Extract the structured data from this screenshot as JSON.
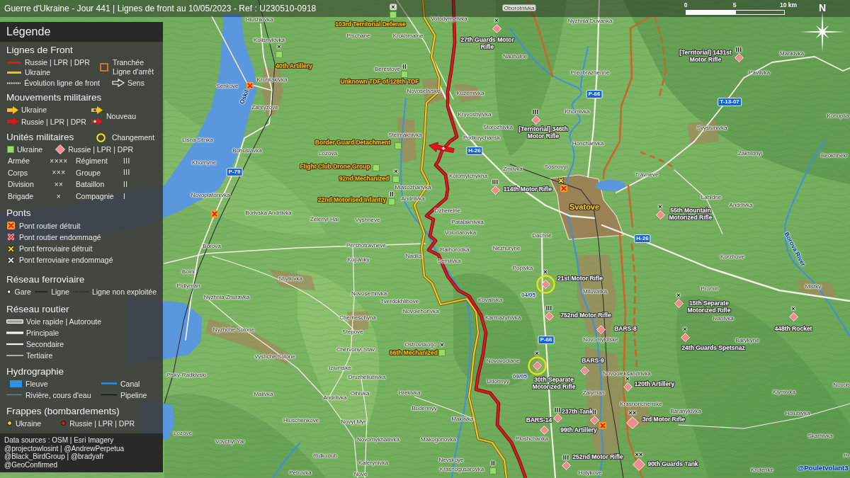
{
  "title": "Guerre d'Ukraine - Jour 441 | Lignes de front au 10/05/2023 - Ref : U230510-0918",
  "scale_bar": {
    "ticks": [
      "0",
      "5",
      "10 km"
    ]
  },
  "compass": {
    "label": "N"
  },
  "legend": {
    "title": "Légende",
    "front_lines": {
      "title": "Lignes de Front",
      "items": [
        {
          "kind": "russia",
          "label": "Russie | LPR | DPR"
        },
        {
          "kind": "ukraine",
          "label": "Ukraine"
        },
        {
          "kind": "evolution",
          "label": "Évolution ligne de front"
        }
      ],
      "trench": "Tranchée\nLigne d'arrêt",
      "direction": "Sens"
    },
    "movements": {
      "title": "Mouvements militaires",
      "items": [
        {
          "kind": "ukraine",
          "label": "Ukraine"
        },
        {
          "kind": "russia",
          "label": "Russie | LPR | DPR"
        }
      ],
      "new_label": "Nouveau"
    },
    "units": {
      "title": "Unités militaires",
      "change_label": "Changement",
      "sides": [
        {
          "kind": "ukraine",
          "label": "Ukraine"
        },
        {
          "kind": "russia",
          "label": "Russie | LPR | DPR"
        }
      ],
      "echelons": [
        {
          "name": "Armée",
          "symbol": "××××"
        },
        {
          "name": "Régiment",
          "symbol": "III"
        },
        {
          "name": "Corps",
          "symbol": "×××"
        },
        {
          "name": "Groupe",
          "symbol": "III"
        },
        {
          "name": "Division",
          "symbol": "××"
        },
        {
          "name": "Bataillon",
          "symbol": "II"
        },
        {
          "name": "Brigade",
          "symbol": "×"
        },
        {
          "name": "Compagnie",
          "symbol": "I"
        }
      ]
    },
    "bridges": {
      "title": "Ponts",
      "items": [
        {
          "kind": "road_destroyed",
          "label": "Pont routier détruit"
        },
        {
          "kind": "road_damaged",
          "label": "Pont routier endommagé"
        },
        {
          "kind": "rail_destroyed",
          "label": "Pont ferroviaire détruit"
        },
        {
          "kind": "rail_damaged",
          "label": "Pont ferroviaire endommagé"
        }
      ]
    },
    "railway": {
      "title": "Réseau ferroviaire",
      "items": [
        {
          "kind": "station",
          "label": "Gare"
        },
        {
          "kind": "line",
          "label": "Ligne"
        },
        {
          "kind": "unused",
          "label": "Ligne non exploitée"
        }
      ]
    },
    "roads": {
      "title": "Réseau routier",
      "items": [
        {
          "kind": "highway",
          "label": "Voie rapide | Autoroute"
        },
        {
          "kind": "primary",
          "label": "Principale"
        },
        {
          "kind": "secondary",
          "label": "Secondaire"
        },
        {
          "kind": "tertiary",
          "label": "Tertiaire"
        }
      ]
    },
    "hydrography": {
      "title": "Hydrographie",
      "items": [
        {
          "kind": "fleuve",
          "label": "Fleuve"
        },
        {
          "kind": "canal",
          "label": "Canal"
        },
        {
          "kind": "river",
          "label": "Rivière, cours d'eau"
        },
        {
          "kind": "pipeline",
          "label": "Pipeline"
        }
      ]
    },
    "strikes": {
      "title": "Frappes (bombardements)",
      "items": [
        {
          "kind": "ukraine",
          "label": "Ukraine"
        },
        {
          "kind": "russia",
          "label": "Russie | LPR | DPR"
        }
      ]
    },
    "sources": [
      "Data sources : OSM | Esri Imagery",
      "@projectowlosint | @AndrewPerpetua",
      "@Black_BirdGroup | @bradyafr",
      "@GeoConfirmed"
    ]
  },
  "map": {
    "places": [
      "Oborotnivka",
      "Hlushkivka",
      "Volodymyrivka",
      "Nyzhnia Duvanka",
      "Kolisnykivka",
      "Pischane",
      "Krokhmalne",
      "Nauholne",
      "Mankivka",
      "Berestove",
      "Preobrazhenne",
      "Pavlivka",
      "Kruhliakivka",
      "Senkove",
      "Novoselivske",
      "Kuzemivka",
      "Zahryzove",
      "Kryvoshyivka",
      "Khomivka",
      "Konoplia",
      "Storozhivka",
      "Svystunivka",
      "Lisna Stinka",
      "Stelmakhivka",
      "Podkuychansk",
      "Honcharivka",
      "Bohuslavka",
      "Lozova",
      "Zakhidnyi",
      "Beokhnekr",
      "Khomyne",
      "Zmiivka",
      "Sosnovyi",
      "Kolomyichykha",
      "Travneve",
      "Miasozharivka",
      "Novoplatonivka",
      "Andriivka",
      "Lahidne",
      "Andriivka",
      "Borivska Andriivka",
      "Dzherelne",
      "Zelenyi Hai",
      "Vyshneve",
      "Patalakhivka",
      "Volodarovka",
      "Dachne",
      "Borova",
      "Pershotravneve",
      "Raihorodka",
      "Nezhuryne",
      "Kopanky",
      "Nadiia",
      "Serhiivka",
      "Korzhove",
      "Boini",
      "Popivka",
      "Shyikivka",
      "Pidlyman",
      "Miluvatka",
      "Promin",
      "Mistky",
      "Nyzhnia Zhuravka",
      "Novoserhiivka",
      "Tverdokhlibove",
      "Kovalivka",
      "Novoiehorivka",
      "Cherneschyna",
      "Karmazynivka",
      "Ivanivka",
      "Nyzhche Solone",
      "Stepove",
      "Ostrovskogo",
      "Novomykilske",
      "Barykyne",
      "Chervonyi Stav",
      "Vyshche Solone",
      "Novovodiane",
      "Iziumske",
      "Pisky-Radkivski",
      "Druzheliubivka",
      "Novooleksandrivka",
      "Udobnyy",
      "Novob",
      "Malivka",
      "Andriivka",
      "Olhivka",
      "Hrekivka",
      "Zalyman",
      "Klymivka",
      "Budennyy",
      "Krasnorichenske",
      "Baranykivka",
      "Holubivka",
      "Hluschenkove",
      "Novyi Myr",
      "Makiivka",
      "Lozove",
      "Vovchyi Yar",
      "Novomykhailivka",
      "Makogonovka",
      "Ploshchanka",
      "Skarhivka",
      "Ridkodub",
      "Pr",
      "Katerynivka",
      "Nevskoye",
      "Petrovka",
      "Nove",
      "Krasnogusarovka",
      "Holykove",
      "Krutenke"
    ],
    "city": "Svatove",
    "river_names": [
      "Oskil",
      "Borova River"
    ],
    "road_numbers": [
      "P-66",
      "T-13-07",
      "H-26",
      "P-79",
      "H-26",
      "P-66"
    ],
    "units": [
      {
        "kind": "ukraine",
        "label": "103rd Territorial Defense",
        "echelon": "×",
        "changed": false
      },
      {
        "kind": "ukraine",
        "label": "40th Artillery",
        "echelon": "×",
        "changed": false
      },
      {
        "kind": "russia",
        "label": "27th Guards Motor\nRifle",
        "echelon": "×",
        "changed": false
      },
      {
        "kind": "russia",
        "label": "[Territorial] 1431st\nMotor Rifle",
        "echelon": "III",
        "changed": false
      },
      {
        "kind": "ukraine",
        "label": "Unknown TDF of 128th TDF",
        "echelon": "II",
        "changed": false
      },
      {
        "kind": "russia",
        "label": "[Territorial] 346th\nMotor Rifle",
        "echelon": "III",
        "changed": false
      },
      {
        "kind": "ukraine",
        "label": "Border Guard Detachment",
        "changed": false
      },
      {
        "kind": "ukraine",
        "label": "Flight Club Drone Group",
        "changed": false
      },
      {
        "kind": "ukraine",
        "label": "92nd Mechanized",
        "echelon": "×",
        "changed": false
      },
      {
        "kind": "ukraine",
        "label": "22nd Motorised Infantry",
        "echelon": "II",
        "changed": false
      },
      {
        "kind": "russia",
        "label": "114th Motor Rifle",
        "echelon": "III",
        "changed": false
      },
      {
        "kind": "russia",
        "label": "55th Mountain\nMotorized Rifle",
        "echelon": "×",
        "changed": false
      },
      {
        "kind": "russia",
        "label": "21st Motor Rifle",
        "echelon": "×",
        "changed": true,
        "date": "04/05"
      },
      {
        "kind": "russia",
        "label": "752nd Motor Rifle",
        "echelon": "III",
        "changed": false
      },
      {
        "kind": "russia",
        "label": "15th Separate\nMotorized Rifle",
        "echelon": "×",
        "changed": false
      },
      {
        "kind": "russia",
        "label": "BARS-8",
        "changed": false
      },
      {
        "kind": "russia",
        "label": "24th Guards Spetsnaz",
        "echelon": "×",
        "changed": false
      },
      {
        "kind": "russia",
        "label": "448th Rocket",
        "echelon": "×",
        "changed": false
      },
      {
        "kind": "ukraine",
        "label": "66th Mechanized",
        "echelon": "×",
        "changed": false
      },
      {
        "kind": "russia",
        "label": "30th Separate\nMotorized Rifle",
        "echelon": "×",
        "changed": true,
        "date": "09/05"
      },
      {
        "kind": "russia",
        "label": "BARS-9",
        "changed": false
      },
      {
        "kind": "russia",
        "label": "120th Artillery",
        "echelon": "×",
        "changed": false
      },
      {
        "kind": "russia",
        "label": "BARS-14",
        "changed": false
      },
      {
        "kind": "russia",
        "label": "237th Tank",
        "echelon": "III",
        "changed": false
      },
      {
        "kind": "russia",
        "label": "99th Artillery",
        "echelon": "II",
        "changed": false
      },
      {
        "kind": "russia",
        "label": "3rd Motor Rifle",
        "echelon": "××",
        "changed": false
      },
      {
        "kind": "ukraine",
        "echelon": "II",
        "changed": false
      },
      {
        "kind": "russia",
        "label": "252nd Motor Rifle",
        "echelon": "III",
        "changed": false
      },
      {
        "kind": "russia",
        "label": "90th Guards Tank",
        "echelon": "××",
        "changed": false
      }
    ],
    "movements": [
      {
        "kind": "russia",
        "new": true
      }
    ],
    "bridges": [
      {
        "kind": "road_destroyed"
      },
      {
        "kind": "rail_destroyed"
      },
      {
        "kind": "road_destroyed"
      },
      {
        "kind": "road_destroyed"
      },
      {
        "kind": "road_destroyed"
      }
    ],
    "credit": "@Pouletvolant3"
  }
}
